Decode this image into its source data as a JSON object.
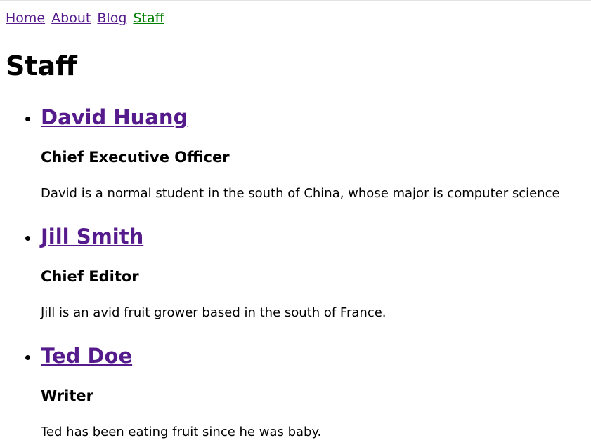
{
  "nav": {
    "links": [
      {
        "label": "Home"
      },
      {
        "label": "About"
      },
      {
        "label": "Blog"
      },
      {
        "label": "Staff"
      }
    ],
    "current_color": "#008000",
    "link_color": "#551a8b"
  },
  "page": {
    "title": "Staff"
  },
  "staff": [
    {
      "name": "David Huang",
      "role": "Chief Executive Officer",
      "bio": "David is a normal student in the south of China, whose major is computer science"
    },
    {
      "name": "Jill Smith",
      "role": "Chief Editor",
      "bio": "Jill is an avid fruit grower based in the south of France."
    },
    {
      "name": "Ted Doe",
      "role": "Writer",
      "bio": "Ted has been eating fruit since he was baby."
    }
  ]
}
